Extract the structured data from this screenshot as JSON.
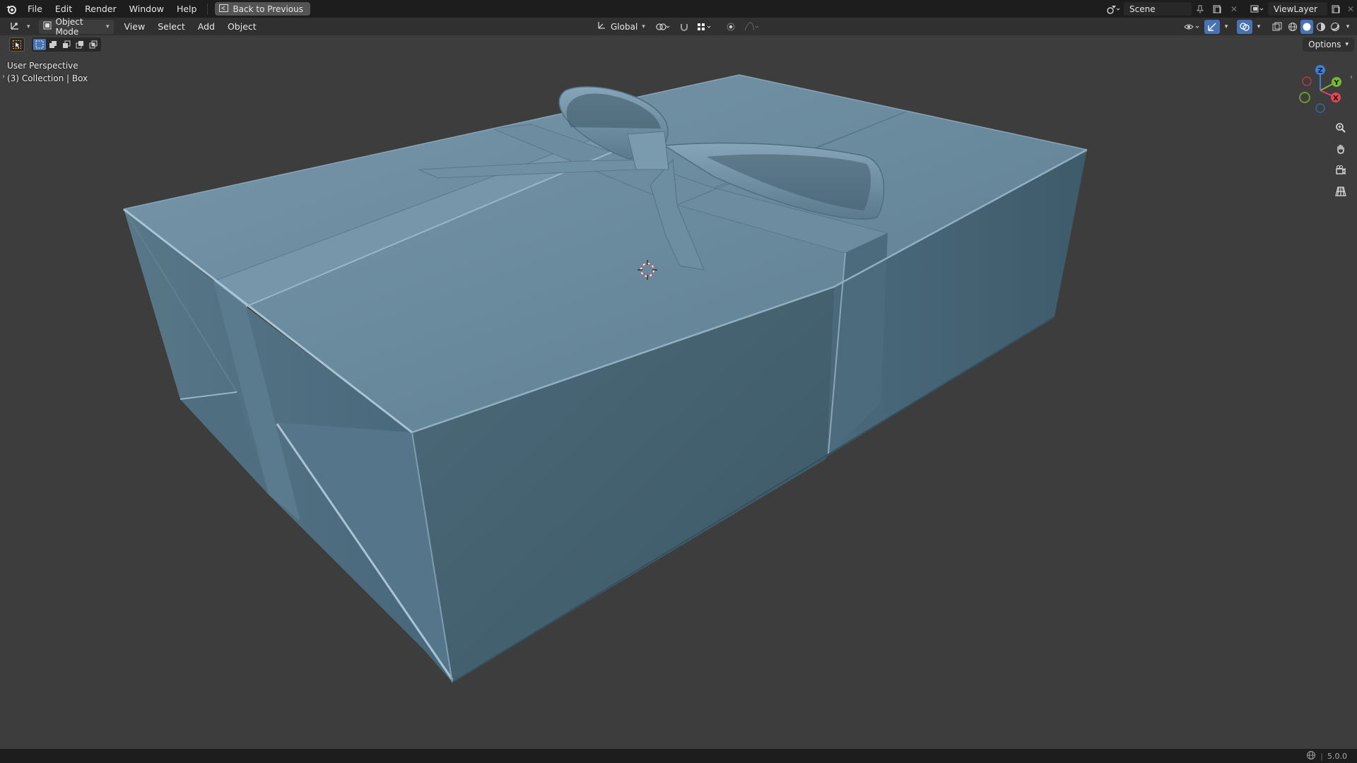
{
  "menubar": {
    "items": [
      "File",
      "Edit",
      "Render",
      "Window",
      "Help"
    ],
    "back_button": "Back to Previous"
  },
  "topright": {
    "scene_name": "Scene",
    "viewlayer_name": "ViewLayer"
  },
  "header": {
    "mode": "Object Mode",
    "menus": [
      "View",
      "Select",
      "Add",
      "Object"
    ],
    "transform_orientation": "Global"
  },
  "toolrow": {
    "options_label": "Options"
  },
  "viewport": {
    "perspective_label": "User Perspective",
    "collection_label": "(3) Collection | Box"
  },
  "gizmo": {
    "x_label": "X",
    "y_label": "Y",
    "z_label": "Z"
  },
  "statusbar": {
    "version": "5.0.0"
  },
  "colors": {
    "box_top": "#6d8ea3",
    "box_front": "#42606f",
    "box_side": "#4b6b7c",
    "background": "#3d3d3d",
    "accent": "#4772b3"
  }
}
